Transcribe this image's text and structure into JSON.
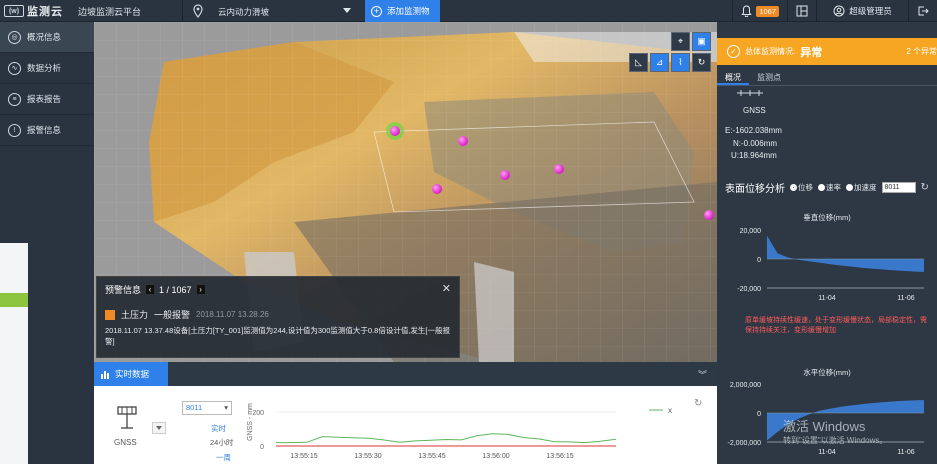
{
  "topbar": {
    "logo_mark": "(w)",
    "logo_text": "监测云",
    "platform": "边坡监测云平台",
    "project": "云内动力滑坡",
    "add_button": "添加监测物",
    "badge_count": "1067",
    "user": "超级管理员"
  },
  "sidebar": {
    "items": [
      {
        "label": "概况信息",
        "icon": "overview-icon",
        "active": true
      },
      {
        "label": "数据分析",
        "icon": "analysis-icon",
        "active": false
      },
      {
        "label": "报表报告",
        "icon": "report-icon",
        "active": false
      },
      {
        "label": "报警信息",
        "icon": "alarm-icon",
        "active": false
      }
    ]
  },
  "alert": {
    "title": "预警信息",
    "pager": "1 / 1067",
    "sensor": "土压力",
    "level": "一般报警",
    "time": "2018.11.07 13.28.26",
    "message": "2018.11.07 13.37.48设备[土压力[TY_001]监测值为244,设计值为300监测值大于0.8倍设计值,发生[一般报警]"
  },
  "realtime": {
    "tab": "实时数据",
    "device": "GNSS",
    "select": "8011",
    "ranges": [
      "实时",
      "24小时",
      "一周"
    ],
    "ylabel": "GNSS - mm",
    "legend": "x",
    "chart_data": {
      "type": "line",
      "x": [
        "13:55:15",
        "13:55:30",
        "13:55:45",
        "13:56:00",
        "13:56:15"
      ],
      "ylim": [
        0,
        200
      ],
      "yticks": [
        "200",
        "0"
      ],
      "series": [
        {
          "name": "x",
          "color": "#5cb85c",
          "values": [
            20,
            20,
            22,
            55,
            52,
            48,
            46,
            35,
            22,
            30,
            34,
            38,
            36,
            60,
            72,
            68,
            50,
            42,
            26,
            24,
            20,
            28,
            40
          ]
        }
      ]
    }
  },
  "right": {
    "status_label": "总体监测情况:",
    "status_value": "异常",
    "status_count": "2 个异常",
    "tabs": [
      "概况",
      "监测点"
    ],
    "gnss_label": "GNSS",
    "e": "E:-1602.038mm",
    "n": "N:-0.006mm",
    "u": "U:18.964mm",
    "surface_title": "表面位移分析",
    "radios": [
      "位移",
      "速率",
      "加速度"
    ],
    "surface_select": "8011",
    "note": "原单缓坡持续性缓速，处于变形缓慢状态，局部稳定性，需保持持续关注，变形缓慢增加",
    "vertical_chart": {
      "title": "垂直位移(mm)",
      "type": "area",
      "yticks": [
        "20,000",
        "0",
        "-20,000"
      ],
      "ylim": [
        -20000,
        20000
      ],
      "xticks": [
        "11-04",
        "11-06"
      ],
      "values": [
        16000,
        4000,
        1000,
        -500,
        -1500,
        -2500,
        -3500,
        -4500,
        -5200,
        -6000,
        -6600,
        -7200,
        -7800,
        -8200,
        -8600,
        -9000
      ]
    },
    "horizontal_chart": {
      "title": "水平位移(mm)",
      "type": "area",
      "yticks": [
        "2,000,000",
        "0",
        "-2,000,000"
      ],
      "ylim": [
        -2000000,
        2000000
      ],
      "xticks": [
        "11-04",
        "11-06"
      ],
      "values": [
        -1900000,
        -1300000,
        -800000,
        -400000,
        -100000,
        150000,
        300000,
        420000,
        520000,
        600000,
        680000,
        740000,
        790000,
        840000,
        870000,
        900000
      ]
    }
  },
  "watermark": {
    "line1": "激活 Windows",
    "line2": "转到\"设置\"以激活 Windows。"
  }
}
